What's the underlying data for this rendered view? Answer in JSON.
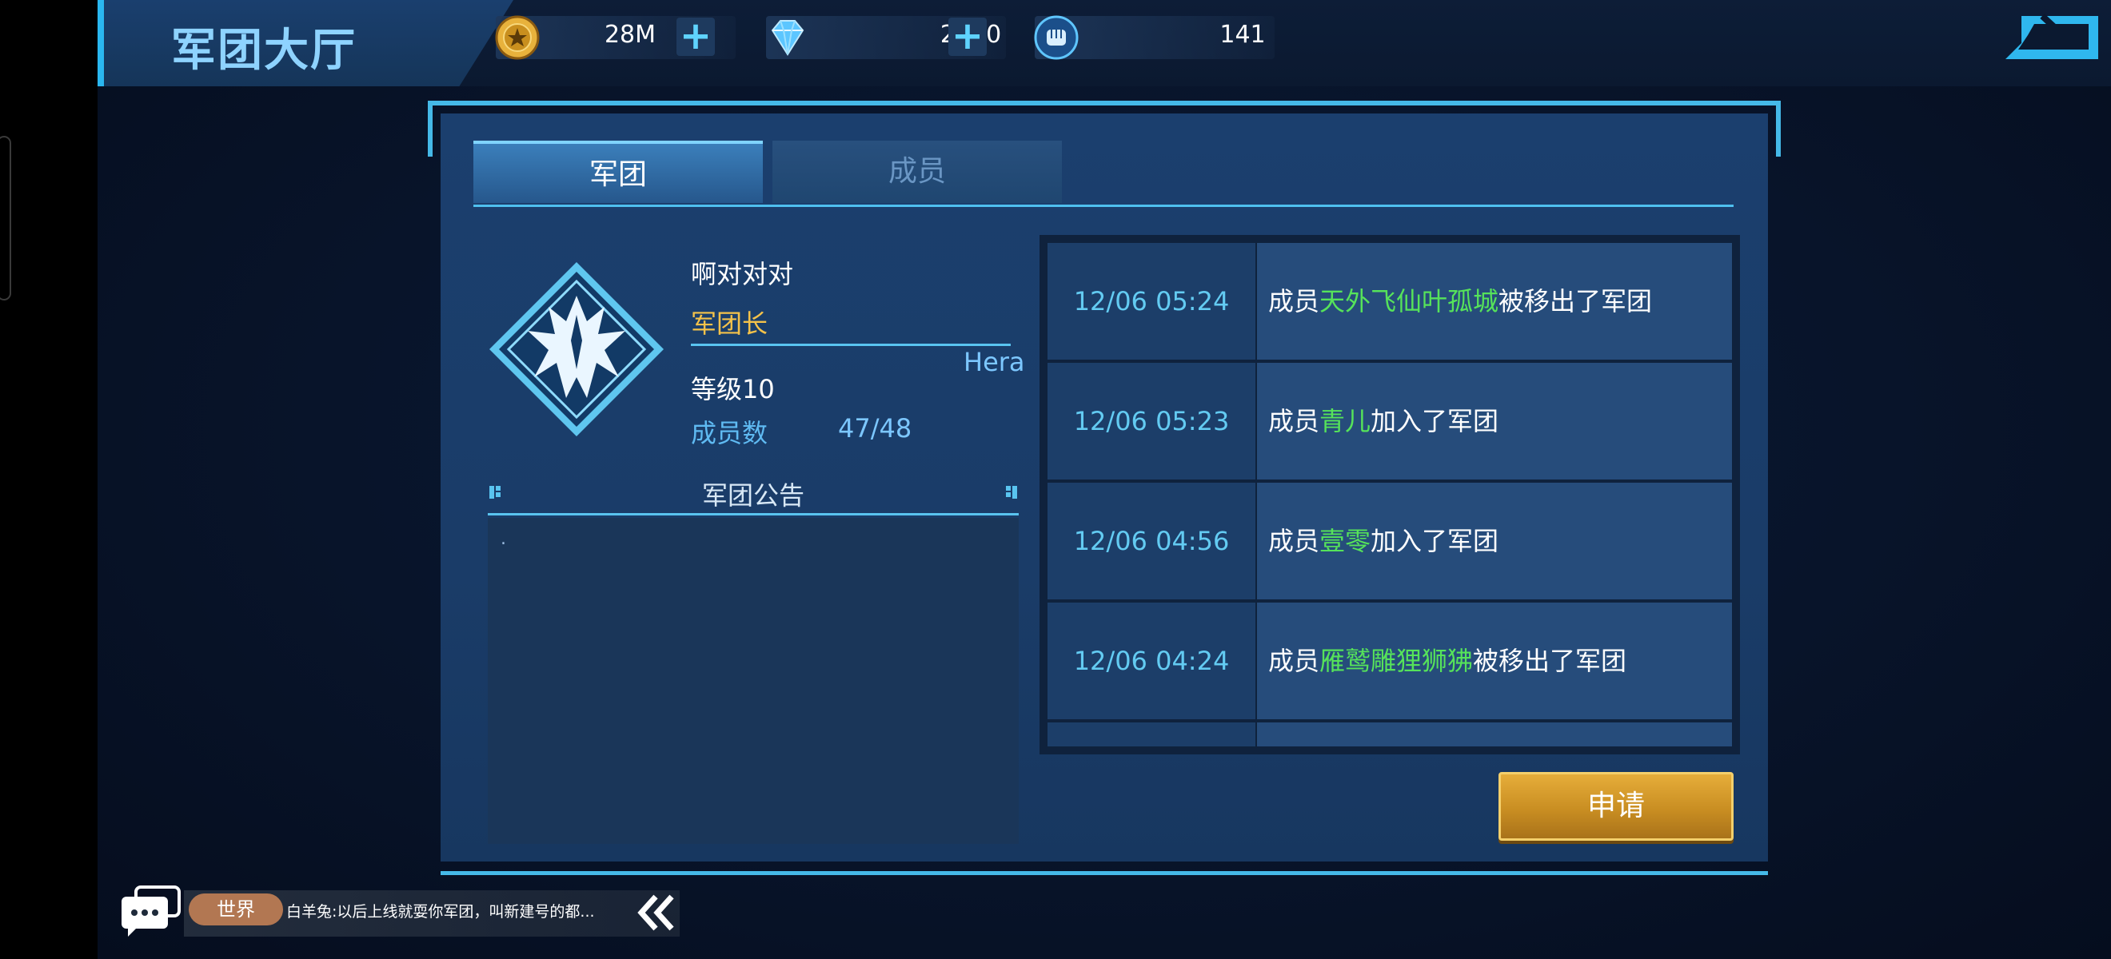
{
  "header": {
    "title": "军团大厅",
    "resources": [
      {
        "icon": "gold-coin-icon",
        "value": "28M"
      },
      {
        "icon": "diamond-icon",
        "value": "2620"
      },
      {
        "icon": "fist-token-icon",
        "value": "141"
      }
    ]
  },
  "tabs": [
    {
      "label": "军团",
      "active": true
    },
    {
      "label": "成员",
      "active": false
    }
  ],
  "legion": {
    "name": "啊对对对",
    "role": "军团长",
    "leader": "Hera",
    "level": "等级10",
    "members_label": "成员数",
    "members_count": "47/48"
  },
  "notice": {
    "title": "军团公告",
    "content": "."
  },
  "logs": [
    {
      "time": "12/06 05:24",
      "prefix": "成员",
      "name": "天外飞仙叶孤城",
      "suffix": "被移出了军团"
    },
    {
      "time": "12/06 05:23",
      "prefix": "成员",
      "name": "青儿",
      "suffix": "加入了军团"
    },
    {
      "time": "12/06 04:56",
      "prefix": "成员",
      "name": "壹零",
      "suffix": "加入了军团"
    },
    {
      "time": "12/06 04:24",
      "prefix": "成员",
      "name": "雁鹫雕狸狮狒",
      "suffix": "被移出了军团"
    }
  ],
  "apply_button": "申请",
  "chat": {
    "channel": "世界",
    "message": "白羊兔:以后上线就耍你军团，叫新建号的都..."
  },
  "colors": {
    "highlight_name": "#56e35a",
    "time": "#63cbf2",
    "role": "#f4c24a",
    "accent": "#45b9e8",
    "button": "#d99e2e"
  }
}
